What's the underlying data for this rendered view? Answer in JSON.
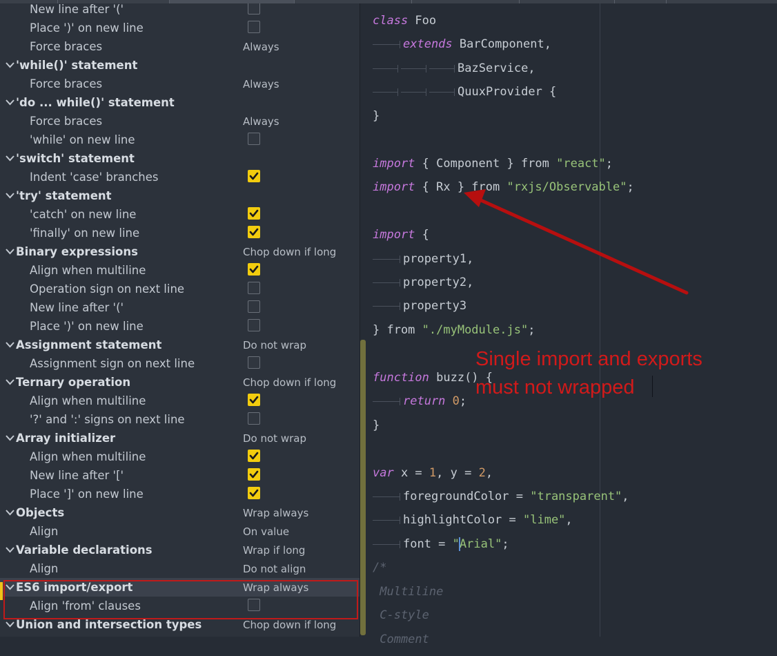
{
  "settings": {
    "rows": [
      {
        "kind": "child",
        "label": "New line after '('",
        "control": "checkbox",
        "checked": false
      },
      {
        "kind": "child",
        "label": "Place ')' on new line",
        "control": "checkbox",
        "checked": false
      },
      {
        "kind": "child",
        "label": "Force braces",
        "control": "value",
        "value": "Always"
      },
      {
        "kind": "section",
        "label": "'while()' statement"
      },
      {
        "kind": "child",
        "label": "Force braces",
        "control": "value",
        "value": "Always"
      },
      {
        "kind": "section",
        "label": "'do ... while()' statement"
      },
      {
        "kind": "child",
        "label": "Force braces",
        "control": "value",
        "value": "Always"
      },
      {
        "kind": "child",
        "label": "'while' on new line",
        "control": "checkbox",
        "checked": false
      },
      {
        "kind": "section",
        "label": "'switch' statement"
      },
      {
        "kind": "child",
        "label": "Indent 'case' branches",
        "control": "checkbox",
        "checked": true
      },
      {
        "kind": "section",
        "label": "'try' statement"
      },
      {
        "kind": "child",
        "label": "'catch' on new line",
        "control": "checkbox",
        "checked": true
      },
      {
        "kind": "child",
        "label": "'finally' on new line",
        "control": "checkbox",
        "checked": true
      },
      {
        "kind": "section",
        "label": "Binary expressions",
        "value": "Chop down if long"
      },
      {
        "kind": "child",
        "label": "Align when multiline",
        "control": "checkbox",
        "checked": true
      },
      {
        "kind": "child",
        "label": "Operation sign on next line",
        "control": "checkbox",
        "checked": false
      },
      {
        "kind": "child",
        "label": "New line after '('",
        "control": "checkbox",
        "checked": false
      },
      {
        "kind": "child",
        "label": "Place ')' on new line",
        "control": "checkbox",
        "checked": false
      },
      {
        "kind": "section",
        "label": "Assignment statement",
        "value": "Do not wrap"
      },
      {
        "kind": "child",
        "label": "Assignment sign on next line",
        "control": "checkbox",
        "checked": false
      },
      {
        "kind": "section",
        "label": "Ternary operation",
        "value": "Chop down if long"
      },
      {
        "kind": "child",
        "label": "Align when multiline",
        "control": "checkbox",
        "checked": true
      },
      {
        "kind": "child",
        "label": "'?' and ':' signs on next line",
        "control": "checkbox",
        "checked": false
      },
      {
        "kind": "section",
        "label": "Array initializer",
        "value": "Do not wrap"
      },
      {
        "kind": "child",
        "label": "Align when multiline",
        "control": "checkbox",
        "checked": true
      },
      {
        "kind": "child",
        "label": "New line after '['",
        "control": "checkbox",
        "checked": true
      },
      {
        "kind": "child",
        "label": "Place ']' on new line",
        "control": "checkbox",
        "checked": true
      },
      {
        "kind": "section",
        "label": "Objects",
        "value": "Wrap always"
      },
      {
        "kind": "child",
        "label": "Align",
        "control": "value",
        "value": "On value"
      },
      {
        "kind": "section",
        "label": "Variable declarations",
        "value": "Wrap if long"
      },
      {
        "kind": "child",
        "label": "Align",
        "control": "value",
        "value": "Do not align"
      },
      {
        "kind": "section",
        "label": "ES6 import/export",
        "value": "Wrap always",
        "selected": true
      },
      {
        "kind": "child",
        "label": "Align 'from' clauses",
        "control": "checkbox",
        "checked": false
      },
      {
        "kind": "section",
        "label": "Union and intersection types",
        "value": "Chop down if long"
      }
    ]
  },
  "code": {
    "lines": [
      [
        [
          "kw",
          "class"
        ],
        [
          "t",
          " Foo"
        ]
      ],
      [
        [
          "tab",
          ""
        ],
        [
          "kw",
          "extends"
        ],
        [
          "t",
          " BarComponent,"
        ]
      ],
      [
        [
          "dots",
          "→→→"
        ],
        [
          "t",
          "BazService,"
        ]
      ],
      [
        [
          "dots",
          "→→→"
        ],
        [
          "t",
          "QuuxProvider {"
        ]
      ],
      [
        [
          "t",
          "}"
        ]
      ],
      [],
      [
        [
          "kw",
          "import"
        ],
        [
          "t",
          " { Component } from "
        ],
        [
          "str",
          "\"react\""
        ],
        [
          "t",
          ";"
        ]
      ],
      [
        [
          "kw",
          "import"
        ],
        [
          "t",
          " { Rx } from "
        ],
        [
          "str",
          "\"rxjs/Observable\""
        ],
        [
          "t",
          ";"
        ]
      ],
      [],
      [
        [
          "kw",
          "import"
        ],
        [
          "t",
          " {"
        ]
      ],
      [
        [
          "tab",
          ""
        ],
        [
          "t",
          "property1,"
        ]
      ],
      [
        [
          "tab",
          ""
        ],
        [
          "t",
          "property2,"
        ]
      ],
      [
        [
          "tab",
          ""
        ],
        [
          "t",
          "property3"
        ]
      ],
      [
        [
          "t",
          "} from "
        ],
        [
          "str",
          "\"./myModule.js\""
        ],
        [
          "t",
          ";"
        ]
      ],
      [],
      [
        [
          "kw",
          "function"
        ],
        [
          "t",
          " buzz() {"
        ]
      ],
      [
        [
          "tab",
          ""
        ],
        [
          "kw",
          "return"
        ],
        [
          "t",
          " "
        ],
        [
          "num",
          "0"
        ],
        [
          "t",
          ";"
        ]
      ],
      [
        [
          "t",
          "}"
        ]
      ],
      [],
      [
        [
          "kw",
          "var"
        ],
        [
          "t",
          " x = "
        ],
        [
          "num",
          "1"
        ],
        [
          "t",
          ", y = "
        ],
        [
          "num",
          "2"
        ],
        [
          "t",
          ","
        ]
      ],
      [
        [
          "tab",
          ""
        ],
        [
          "t",
          "foregroundColor = "
        ],
        [
          "str",
          "\"transparent\""
        ],
        [
          "t",
          ","
        ]
      ],
      [
        [
          "tab",
          ""
        ],
        [
          "t",
          "highlightColor = "
        ],
        [
          "str",
          "\"lime\""
        ],
        [
          "t",
          ","
        ]
      ],
      [
        [
          "tab",
          ""
        ],
        [
          "t",
          "font = "
        ],
        [
          "str",
          "\""
        ],
        [
          "caret",
          ""
        ],
        [
          "str",
          "Arial\""
        ],
        [
          "t",
          ";"
        ]
      ],
      [
        [
          "cmt",
          "/*"
        ]
      ],
      [
        [
          "cmt",
          " Multiline"
        ]
      ],
      [
        [
          "cmt",
          " C-style"
        ]
      ],
      [
        [
          "cmt",
          " Comment"
        ]
      ]
    ]
  },
  "annotation": {
    "line1": "Single import and exports",
    "line2": "must not wrapped"
  },
  "colors": {
    "accent_checkbox": "#f2cc0e",
    "annotation_red": "#d11a1a",
    "keyword": "#c678dd",
    "string": "#98c379",
    "number": "#d19a66"
  }
}
